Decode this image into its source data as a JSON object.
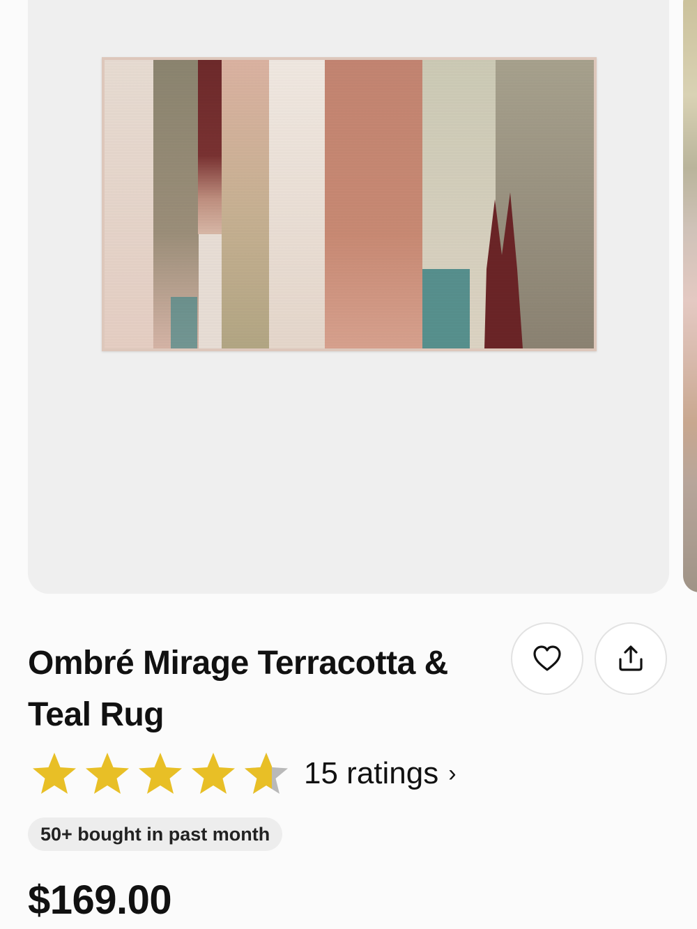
{
  "product": {
    "title": "Ombré Mirage Terracotta & Teal Rug",
    "rating": 4.5,
    "rating_count_label": "15 ratings",
    "rating_chevron": "›",
    "badge": "50+ bought in past month",
    "price": "$169.00"
  },
  "actions": {
    "favorite_icon": "heart-icon",
    "share_icon": "share-icon"
  },
  "colors": {
    "star": "#e8bf26",
    "star_empty": "#b9b9b9",
    "image_background": "#efefef",
    "badge_background": "#ededed"
  }
}
